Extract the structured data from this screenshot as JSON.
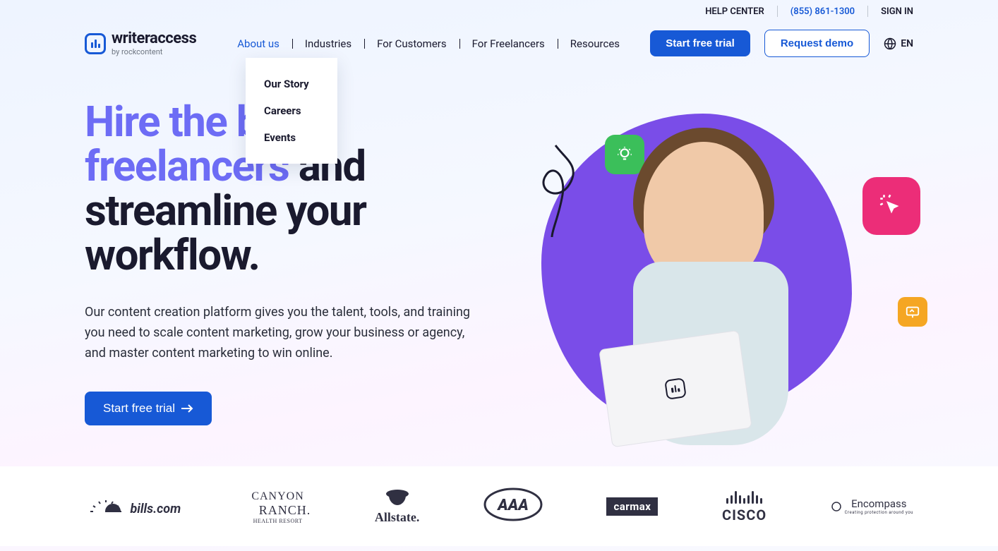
{
  "topbar": {
    "help": "HELP CENTER",
    "phone": "(855) 861-1300",
    "signin": "SIGN IN"
  },
  "logo": {
    "main": "writeraccess",
    "sub": "by rockcontent"
  },
  "nav": {
    "about": "About us",
    "industries": "Industries",
    "customers": "For Customers",
    "freelancers": "For Freelancers",
    "resources": "Resources"
  },
  "dropdown": {
    "story": "Our Story",
    "careers": "Careers",
    "events": "Events"
  },
  "actions": {
    "trial": "Start free trial",
    "demo": "Request demo",
    "lang": "EN"
  },
  "hero": {
    "h1_highlight1": "Hire the best freelancers",
    "h1_rest1": " and streamline your ",
    "h1_bold": "workflow.",
    "sub": "Our content creation platform gives you the talent, tools, and training you need to scale content marketing, grow your business or agency, and master content marketing to win online.",
    "cta": "Start free trial"
  },
  "clients": {
    "bills": "bills.com",
    "canyon1": "CANYON",
    "canyon2": "RANCH.",
    "canyon3": "HEALTH RESORT",
    "allstate": "Allstate.",
    "aaa": "AAA",
    "carmax": "carmax",
    "cisco": "CISCO",
    "encompass": "Encompass"
  }
}
